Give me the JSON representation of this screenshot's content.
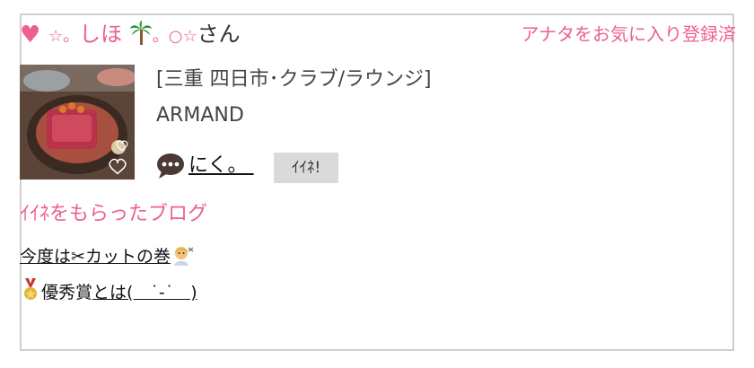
{
  "user": {
    "name_prefix": "☆。",
    "name_main": "しほ",
    "name_suffix": "。○☆",
    "honorific": "さん",
    "palm_icon": "palm-tree-icon",
    "heart_icon": "heart-icon",
    "favorite_status": "アナタをお気に入り登録済"
  },
  "shop": {
    "location": "[三重 四日市･クラブ/ラウンジ]",
    "name": "ARMAND",
    "thumbnail_icon": "food-photo"
  },
  "post": {
    "comment": "にく。 ",
    "comment_icon": "speech-bubble-icon",
    "like_label": "ｲｲﾈ!"
  },
  "blogs": {
    "title": "ｲｲﾈをもらったブログ",
    "items": [
      {
        "text_before": "今度は",
        "scissors": "✂",
        "text_after": "カットの巻",
        "emoji": "barber-person-icon"
      },
      {
        "emoji": "medal-icon",
        "text_plain": "優秀賞",
        "text_link": "とは(　˙-˙　)"
      }
    ]
  },
  "colors": {
    "accent_pink": "#ee5f8f",
    "border_gray": "#cfcfcf",
    "button_gray": "#dadada"
  }
}
